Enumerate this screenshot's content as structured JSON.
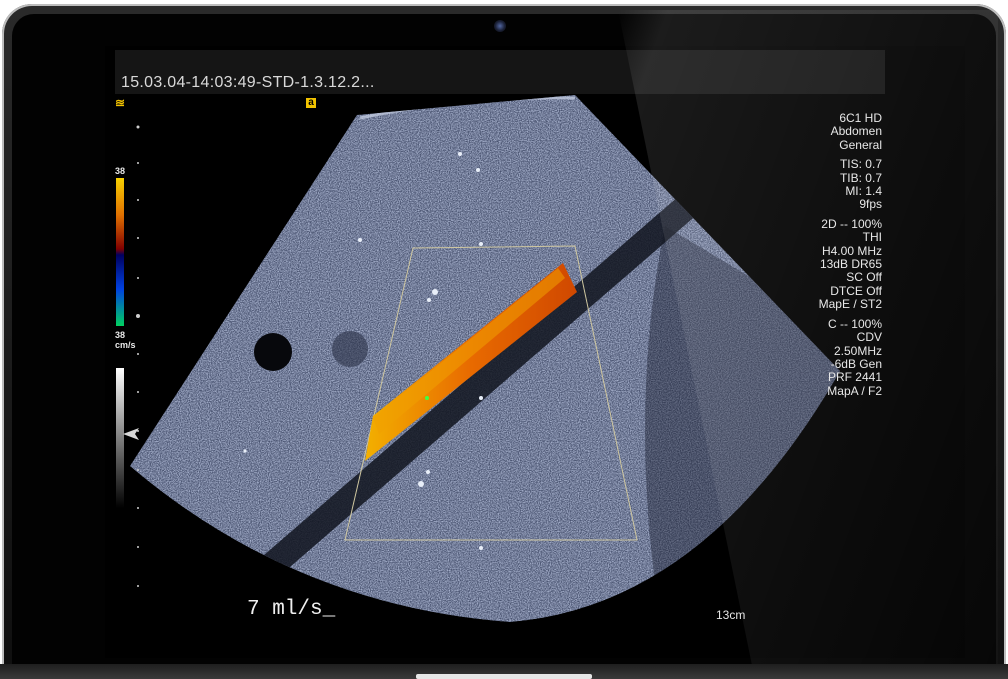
{
  "header": {
    "study_id": "15.03.04-14:03:49-STD-1.3.12.2..."
  },
  "probe": {
    "lines": [
      "6C1 HD",
      "Abdomen",
      "General"
    ]
  },
  "safety": {
    "lines": [
      "TIS: 0.7",
      "TIB: 0.7",
      "MI: 1.4",
      "9fps"
    ]
  },
  "mode_2d": {
    "lines": [
      "2D -- 100%",
      "THI",
      "H4.00 MHz",
      "13dB DR65",
      "SC Off",
      "DTCE Off",
      "MapE / ST2"
    ]
  },
  "mode_color": {
    "lines": [
      "C -- 100%",
      "CDV",
      "2.50MHz",
      "-6dB Gen",
      "PRF 2441",
      "MapA / F2"
    ]
  },
  "color_scale": {
    "top": "38",
    "bottom": "38",
    "unit": "cm/s"
  },
  "flow_rate": "7 ml/s_",
  "depth": "13cm",
  "icons": {
    "left": "grayscale-map-icon",
    "right": "freeze-indicator-icon"
  },
  "colors": {
    "scale_warm": "#f2b400",
    "scale_cool": "#00c060",
    "flow": "#e06000"
  }
}
